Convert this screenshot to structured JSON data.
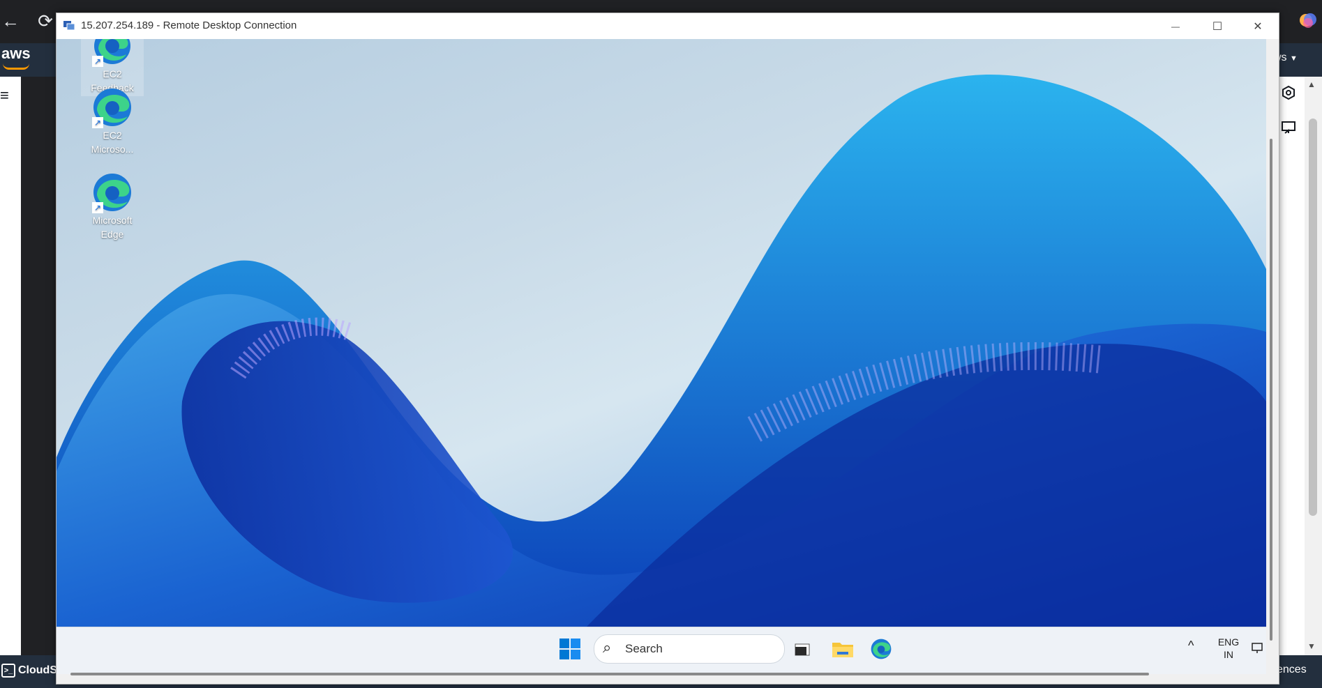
{
  "host_browser": {
    "back_glyph": "←",
    "reload_glyph": "⟳",
    "aws_logo": "aws",
    "region_fragment": "ws",
    "dropdown_glyph": "▼",
    "menu_glyph": "≡",
    "cloudshell_label": "CloudSh",
    "cloudshell_glyph": ">_",
    "preferences_fragment": "ences"
  },
  "rdp_window": {
    "title": "15.207.254.189 - Remote Desktop Connection",
    "minimize_glyph": "—",
    "maximize_glyph": "☐",
    "close_glyph": "✕"
  },
  "desktop": {
    "icons": [
      {
        "line1": "EC2",
        "line2": "Feedback",
        "icon": "edge-icon"
      },
      {
        "line1": "EC2",
        "line2": "Microso...",
        "icon": "edge-icon"
      },
      {
        "line1": "Microsoft",
        "line2": "Edge",
        "icon": "edge-icon"
      }
    ]
  },
  "taskbar": {
    "search_placeholder": "Search",
    "search_glyph": "⌕",
    "tray_chevron": "^",
    "lang_line1": "ENG",
    "lang_line2": "IN"
  },
  "colors": {
    "aws_navy": "#232f3e",
    "aws_orange": "#ff9900",
    "windows_blue": "#0078d4",
    "desktop_sky": "#c9dbe8"
  }
}
